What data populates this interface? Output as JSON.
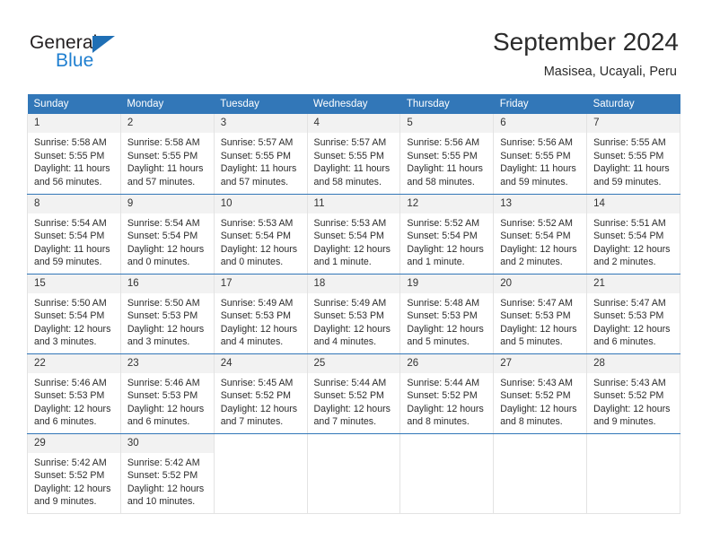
{
  "brand": {
    "name_part1": "General",
    "name_part2": "Blue",
    "accent_color": "#1f7fd0",
    "triangle_color": "#1f6fb5"
  },
  "header": {
    "title": "September 2024",
    "subtitle": "Masisea, Ucayali, Peru"
  },
  "theme": {
    "header_blue": "#3277b8",
    "daynum_band": "#f2f2f2",
    "cell_border": "#e3e3e3",
    "text": "#2b2b2b"
  },
  "weekday_headers": [
    "Sunday",
    "Monday",
    "Tuesday",
    "Wednesday",
    "Thursday",
    "Friday",
    "Saturday"
  ],
  "weeks": [
    [
      {
        "day": "1",
        "sunrise": "Sunrise: 5:58 AM",
        "sunset": "Sunset: 5:55 PM",
        "daylight": "Daylight: 11 hours and 56 minutes."
      },
      {
        "day": "2",
        "sunrise": "Sunrise: 5:58 AM",
        "sunset": "Sunset: 5:55 PM",
        "daylight": "Daylight: 11 hours and 57 minutes."
      },
      {
        "day": "3",
        "sunrise": "Sunrise: 5:57 AM",
        "sunset": "Sunset: 5:55 PM",
        "daylight": "Daylight: 11 hours and 57 minutes."
      },
      {
        "day": "4",
        "sunrise": "Sunrise: 5:57 AM",
        "sunset": "Sunset: 5:55 PM",
        "daylight": "Daylight: 11 hours and 58 minutes."
      },
      {
        "day": "5",
        "sunrise": "Sunrise: 5:56 AM",
        "sunset": "Sunset: 5:55 PM",
        "daylight": "Daylight: 11 hours and 58 minutes."
      },
      {
        "day": "6",
        "sunrise": "Sunrise: 5:56 AM",
        "sunset": "Sunset: 5:55 PM",
        "daylight": "Daylight: 11 hours and 59 minutes."
      },
      {
        "day": "7",
        "sunrise": "Sunrise: 5:55 AM",
        "sunset": "Sunset: 5:55 PM",
        "daylight": "Daylight: 11 hours and 59 minutes."
      }
    ],
    [
      {
        "day": "8",
        "sunrise": "Sunrise: 5:54 AM",
        "sunset": "Sunset: 5:54 PM",
        "daylight": "Daylight: 11 hours and 59 minutes."
      },
      {
        "day": "9",
        "sunrise": "Sunrise: 5:54 AM",
        "sunset": "Sunset: 5:54 PM",
        "daylight": "Daylight: 12 hours and 0 minutes."
      },
      {
        "day": "10",
        "sunrise": "Sunrise: 5:53 AM",
        "sunset": "Sunset: 5:54 PM",
        "daylight": "Daylight: 12 hours and 0 minutes."
      },
      {
        "day": "11",
        "sunrise": "Sunrise: 5:53 AM",
        "sunset": "Sunset: 5:54 PM",
        "daylight": "Daylight: 12 hours and 1 minute."
      },
      {
        "day": "12",
        "sunrise": "Sunrise: 5:52 AM",
        "sunset": "Sunset: 5:54 PM",
        "daylight": "Daylight: 12 hours and 1 minute."
      },
      {
        "day": "13",
        "sunrise": "Sunrise: 5:52 AM",
        "sunset": "Sunset: 5:54 PM",
        "daylight": "Daylight: 12 hours and 2 minutes."
      },
      {
        "day": "14",
        "sunrise": "Sunrise: 5:51 AM",
        "sunset": "Sunset: 5:54 PM",
        "daylight": "Daylight: 12 hours and 2 minutes."
      }
    ],
    [
      {
        "day": "15",
        "sunrise": "Sunrise: 5:50 AM",
        "sunset": "Sunset: 5:54 PM",
        "daylight": "Daylight: 12 hours and 3 minutes."
      },
      {
        "day": "16",
        "sunrise": "Sunrise: 5:50 AM",
        "sunset": "Sunset: 5:53 PM",
        "daylight": "Daylight: 12 hours and 3 minutes."
      },
      {
        "day": "17",
        "sunrise": "Sunrise: 5:49 AM",
        "sunset": "Sunset: 5:53 PM",
        "daylight": "Daylight: 12 hours and 4 minutes."
      },
      {
        "day": "18",
        "sunrise": "Sunrise: 5:49 AM",
        "sunset": "Sunset: 5:53 PM",
        "daylight": "Daylight: 12 hours and 4 minutes."
      },
      {
        "day": "19",
        "sunrise": "Sunrise: 5:48 AM",
        "sunset": "Sunset: 5:53 PM",
        "daylight": "Daylight: 12 hours and 5 minutes."
      },
      {
        "day": "20",
        "sunrise": "Sunrise: 5:47 AM",
        "sunset": "Sunset: 5:53 PM",
        "daylight": "Daylight: 12 hours and 5 minutes."
      },
      {
        "day": "21",
        "sunrise": "Sunrise: 5:47 AM",
        "sunset": "Sunset: 5:53 PM",
        "daylight": "Daylight: 12 hours and 6 minutes."
      }
    ],
    [
      {
        "day": "22",
        "sunrise": "Sunrise: 5:46 AM",
        "sunset": "Sunset: 5:53 PM",
        "daylight": "Daylight: 12 hours and 6 minutes."
      },
      {
        "day": "23",
        "sunrise": "Sunrise: 5:46 AM",
        "sunset": "Sunset: 5:53 PM",
        "daylight": "Daylight: 12 hours and 6 minutes."
      },
      {
        "day": "24",
        "sunrise": "Sunrise: 5:45 AM",
        "sunset": "Sunset: 5:52 PM",
        "daylight": "Daylight: 12 hours and 7 minutes."
      },
      {
        "day": "25",
        "sunrise": "Sunrise: 5:44 AM",
        "sunset": "Sunset: 5:52 PM",
        "daylight": "Daylight: 12 hours and 7 minutes."
      },
      {
        "day": "26",
        "sunrise": "Sunrise: 5:44 AM",
        "sunset": "Sunset: 5:52 PM",
        "daylight": "Daylight: 12 hours and 8 minutes."
      },
      {
        "day": "27",
        "sunrise": "Sunrise: 5:43 AM",
        "sunset": "Sunset: 5:52 PM",
        "daylight": "Daylight: 12 hours and 8 minutes."
      },
      {
        "day": "28",
        "sunrise": "Sunrise: 5:43 AM",
        "sunset": "Sunset: 5:52 PM",
        "daylight": "Daylight: 12 hours and 9 minutes."
      }
    ],
    [
      {
        "day": "29",
        "sunrise": "Sunrise: 5:42 AM",
        "sunset": "Sunset: 5:52 PM",
        "daylight": "Daylight: 12 hours and 9 minutes."
      },
      {
        "day": "30",
        "sunrise": "Sunrise: 5:42 AM",
        "sunset": "Sunset: 5:52 PM",
        "daylight": "Daylight: 12 hours and 10 minutes."
      },
      {
        "day": "",
        "sunrise": "",
        "sunset": "",
        "daylight": ""
      },
      {
        "day": "",
        "sunrise": "",
        "sunset": "",
        "daylight": ""
      },
      {
        "day": "",
        "sunrise": "",
        "sunset": "",
        "daylight": ""
      },
      {
        "day": "",
        "sunrise": "",
        "sunset": "",
        "daylight": ""
      },
      {
        "day": "",
        "sunrise": "",
        "sunset": "",
        "daylight": ""
      }
    ]
  ]
}
